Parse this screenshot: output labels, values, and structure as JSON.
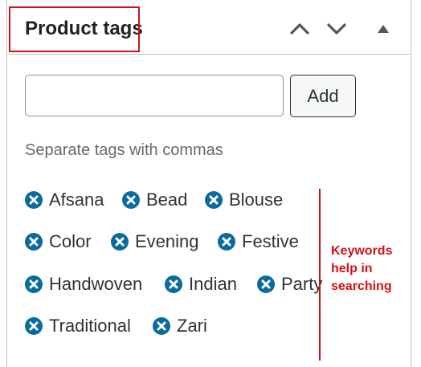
{
  "panel": {
    "title": "Product tags",
    "controls": [
      {
        "name": "move-up-button",
        "icon": "chevron-up-icon"
      },
      {
        "name": "move-down-button",
        "icon": "chevron-down-icon"
      },
      {
        "name": "toggle-panel-button",
        "icon": "triangle-up-icon"
      }
    ]
  },
  "tag_input": {
    "value": "",
    "placeholder": ""
  },
  "add_button": {
    "label": "Add"
  },
  "hint": "Separate tags with commas",
  "tags": [
    {
      "label": "Afsana"
    },
    {
      "label": "Bead"
    },
    {
      "label": "Blouse"
    },
    {
      "label": "Color"
    },
    {
      "label": "Evening"
    },
    {
      "label": "Festive"
    },
    {
      "label": "Handwoven"
    },
    {
      "label": "Indian"
    },
    {
      "label": "Party"
    },
    {
      "label": "Traditional"
    },
    {
      "label": "Zari"
    }
  ],
  "annotation": {
    "line1": "Keywords",
    "line2": "help in",
    "line3": "searching"
  },
  "colors": {
    "remove_icon": "#0a6c9c",
    "annotation_red": "#d0111b",
    "title_text": "#1d2327",
    "hint_text": "#646970"
  }
}
